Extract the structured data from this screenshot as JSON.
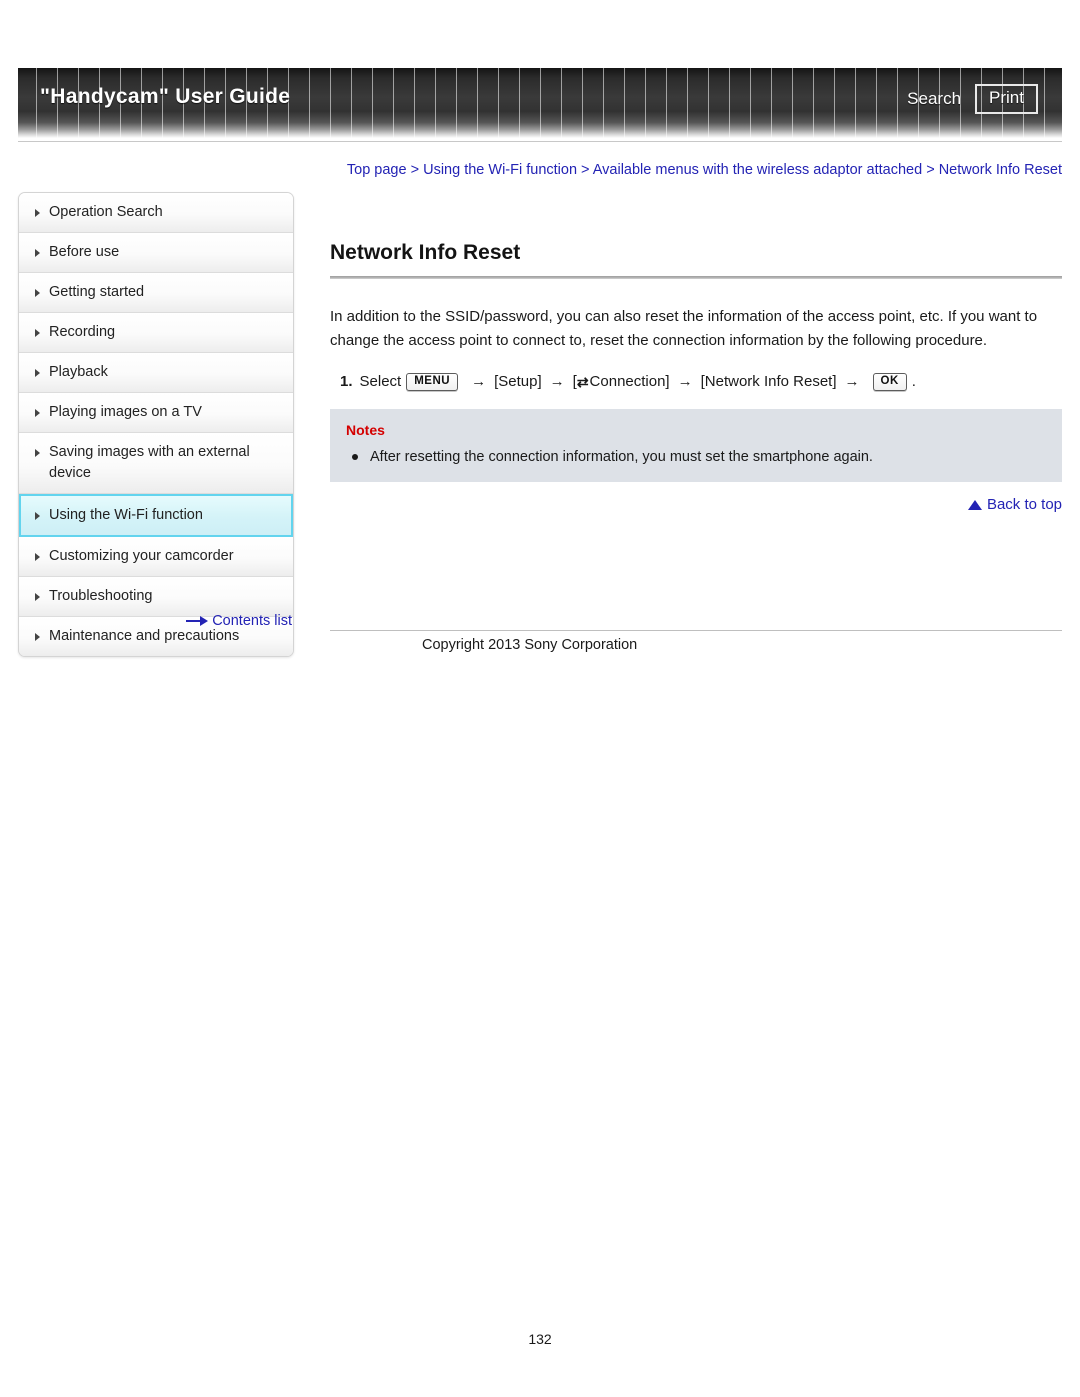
{
  "header": {
    "title": "\"Handycam\" User Guide",
    "search_label": "Search",
    "print_label": "Print"
  },
  "breadcrumb": {
    "items": [
      "Top page",
      "Using the Wi-Fi function",
      "Available menus with the wireless adaptor attached",
      "Network Info Reset"
    ],
    "separator": ">",
    "full_text": "Top page > Using the Wi-Fi function > Available menus with the wireless adaptor attached > Network Info Reset"
  },
  "sidebar": {
    "items": [
      {
        "label": "Operation Search",
        "selected": false
      },
      {
        "label": "Before use",
        "selected": false
      },
      {
        "label": "Getting started",
        "selected": false
      },
      {
        "label": "Recording",
        "selected": false
      },
      {
        "label": "Playback",
        "selected": false
      },
      {
        "label": "Playing images on a TV",
        "selected": false
      },
      {
        "label": "Saving images with an external device",
        "selected": false
      },
      {
        "label": "Using the Wi-Fi function",
        "selected": true
      },
      {
        "label": "Customizing your camcorder",
        "selected": false
      },
      {
        "label": "Troubleshooting",
        "selected": false
      },
      {
        "label": "Maintenance and precautions",
        "selected": false
      }
    ],
    "contents_list_label": "Contents list"
  },
  "main": {
    "heading": "Network Info Reset",
    "paragraph": "In addition to the SSID/password, you can also reset the information of the access point, etc. If you want to change the access point to connect to, reset the connection information by the following procedure.",
    "step": {
      "number": "1.",
      "select_label": "Select",
      "menu_key": "MENU",
      "arrow": "→",
      "setup_label": "[Setup]",
      "connection_open": "[",
      "connection_icon": "⇄",
      "connection_label": "Connection]",
      "network_info_reset_label": "[Network Info Reset]",
      "ok_key": "OK",
      "period": "."
    },
    "notes": {
      "title": "Notes",
      "items": [
        "After resetting the connection information, you must set the smartphone again."
      ]
    },
    "back_to_top_label": "Back to top"
  },
  "footer": {
    "copyright": "Copyright 2013 Sony Corporation",
    "page_number": "132"
  },
  "colors": {
    "link_blue": "#2323b4",
    "notes_red": "#d40000",
    "notes_bg": "#dde1e7",
    "selected_border": "#62d4ee"
  }
}
